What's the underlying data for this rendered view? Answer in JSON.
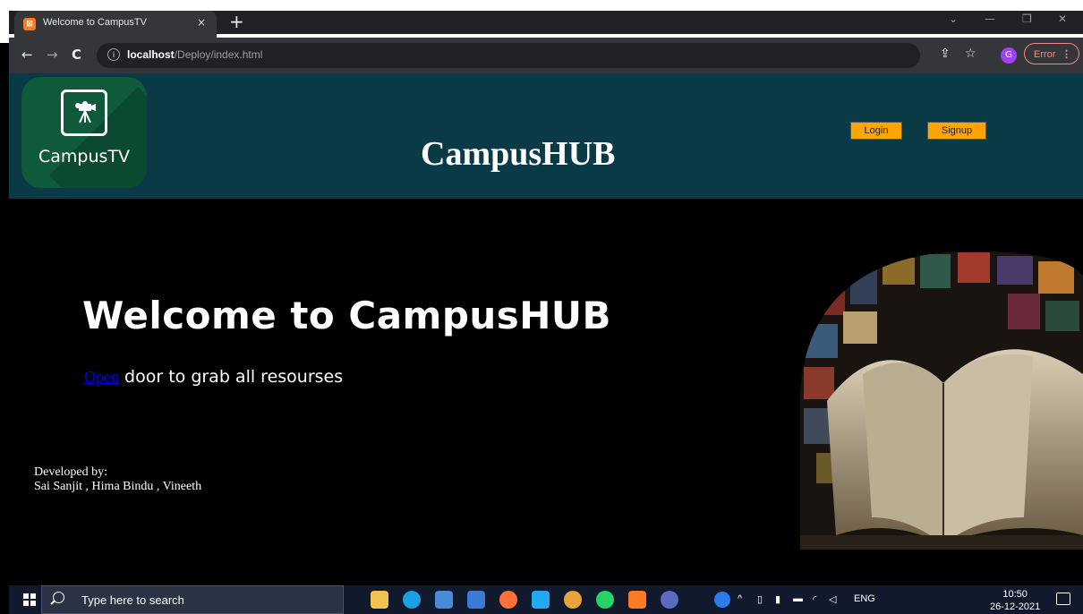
{
  "browser": {
    "tab_title": "Welcome to CampusTV",
    "tab_close": "×",
    "new_tab": "+",
    "url_host": "localhost",
    "url_path": "/Deploy/index.html",
    "profile_initial": "G",
    "error_label": "Error",
    "error_menu": "⋮",
    "back": "←",
    "forward": "→",
    "reload": "C",
    "share": "⇪",
    "star": "☆",
    "minimize": "—",
    "restore": "❐",
    "close": "✕",
    "chevron": "⌄"
  },
  "header": {
    "logo_text": "CampusTV",
    "title": "CampusHUB",
    "login_label": "Login",
    "signup_label": "Signup"
  },
  "hero": {
    "title": "Welcome to CampusHUB",
    "link_text": "Open",
    "subtitle_rest": " door to grab all resourses"
  },
  "credits": {
    "line1": "Developed by:",
    "line2": "Sai Sanjit , Hima Bindu , Vineeth"
  },
  "taskbar": {
    "search_placeholder": "Type here to search",
    "language": "ENG",
    "time": "10:50",
    "date": "26-12-2021"
  },
  "colors": {
    "header_bg": "#0a3a46",
    "button_bg": "#ffa500",
    "link": "#0000ee",
    "page_bg": "#000000"
  }
}
